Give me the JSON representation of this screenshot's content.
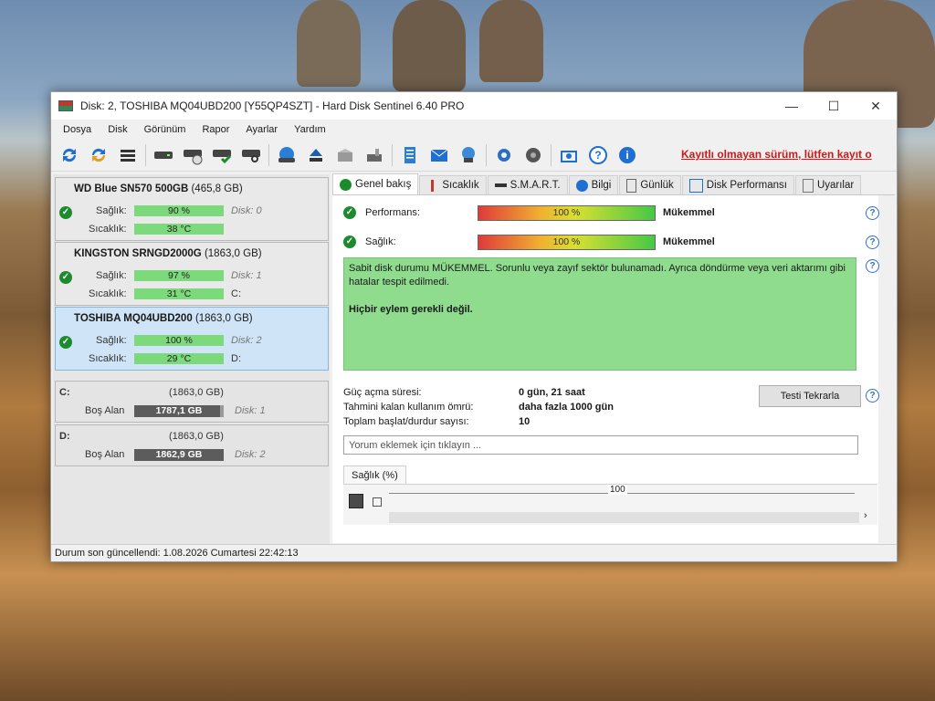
{
  "window": {
    "title": "Disk: 2, TOSHIBA MQ04UBD200 [Y55QP4SZT]  -  Hard Disk Sentinel 6.40 PRO",
    "controls": {
      "minimize": "—",
      "maximize": "☐",
      "close": "✕"
    }
  },
  "menu": [
    "Dosya",
    "Disk",
    "Görünüm",
    "Rapor",
    "Ayarlar",
    "Yardım"
  ],
  "toolbar": {
    "unregistered_text": "Kayıtlı olmayan sürüm, lütfen kayıt o"
  },
  "disks": [
    {
      "name": "WD Blue SN570 500GB",
      "size": "(465,8 GB)",
      "health_label": "Sağlık:",
      "health": "90 %",
      "health_pct": 90,
      "temp_label": "Sıcaklık:",
      "temp": "38 °C",
      "disk": "Disk: 0",
      "drive": ""
    },
    {
      "name": "KINGSTON SRNGD2000G",
      "size": "(1863,0 GB)",
      "health_label": "Sağlık:",
      "health": "97 %",
      "health_pct": 97,
      "temp_label": "Sıcaklık:",
      "temp": "31 °C",
      "disk": "Disk: 1",
      "drive": "C:"
    },
    {
      "name": "TOSHIBA MQ04UBD200",
      "size": "(1863,0 GB)",
      "health_label": "Sağlık:",
      "health": "100 %",
      "health_pct": 100,
      "temp_label": "Sıcaklık:",
      "temp": "29 °C",
      "disk": "Disk: 2",
      "drive": "D:"
    }
  ],
  "volumes": [
    {
      "letter": "C:",
      "size": "(1863,0 GB)",
      "free_label": "Boş Alan",
      "free": "1787,1 GB",
      "free_pct": 96,
      "disk": "Disk: 1"
    },
    {
      "letter": "D:",
      "size": "(1863,0 GB)",
      "free_label": "Boş Alan",
      "free": "1862,9 GB",
      "free_pct": 100,
      "disk": "Disk: 2"
    }
  ],
  "status_bar": "Durum son güncellendi: 1.08.2026 Cumartesi 22:42:13",
  "tabs": [
    "Genel bakış",
    "Sıcaklık",
    "S.M.A.R.T.",
    "Bilgi",
    "Günlük",
    "Disk Performansı",
    "Uyarılar"
  ],
  "overview": {
    "performance_label": "Performans:",
    "performance_value": "100 %",
    "performance_pct": 100,
    "performance_rating": "Mükemmel",
    "health_label": "Sağlık:",
    "health_value": "100 %",
    "health_pct": 100,
    "health_rating": "Mükemmel",
    "message_line1": "Sabit disk durumu MÜKEMMEL. Sorunlu veya zayıf sektör bulunamadı. Ayrıca döndürme veya veri aktarımı gibi hatalar tespit edilmedi.",
    "message_line2": "Hiçbir eylem gerekli değil.",
    "power_on_label": "Güç açma süresi:",
    "power_on_value": "0 gün, 21 saat",
    "lifetime_label": "Tahmini kalan kullanım ömrü:",
    "lifetime_value": "daha fazla 1000 gün",
    "startstop_label": "Toplam başlat/durdur sayısı:",
    "startstop_value": "10",
    "retest_button": "Testi Tekrarla",
    "comment_placeholder": "Yorum eklemek için tıklayın ...",
    "health_chart_tab": "Sağlık (%)",
    "health_chart_value": "100"
  },
  "colors": {
    "good": "#1e8a2e",
    "bar_green": "#7cd97c",
    "message_bg": "#8fdc8f",
    "unregistered": "#d01818"
  }
}
